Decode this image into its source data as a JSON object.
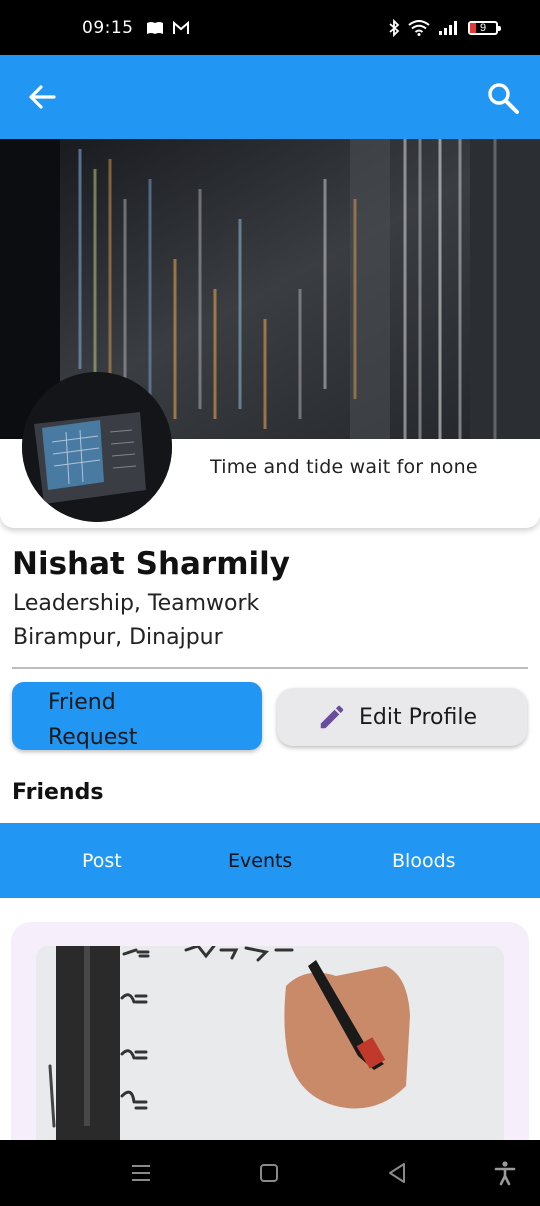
{
  "status_bar": {
    "time": "09:15",
    "battery": "9"
  },
  "app_bar": {
    "back_icon": "arrow-left-icon",
    "search_icon": "search-icon"
  },
  "profile": {
    "quote": "Time and tide wait for none",
    "name": "Nishat Sharmily",
    "skills": "Leadership, Teamwork",
    "location": "Birampur, Dinajpur"
  },
  "actions": {
    "friend_request_line1": "Friend",
    "friend_request_line2": "Request",
    "edit_profile": "Edit Profile"
  },
  "friends_title": "Friends",
  "tabs": [
    {
      "label": "Post"
    },
    {
      "label": "Events"
    },
    {
      "label": "Bloods"
    }
  ],
  "colors": {
    "accent": "#2196F3",
    "edit_icon": "#6A4C9C",
    "card_bg": "#F6EEFA"
  },
  "nav_bar": {
    "items": [
      "recent-apps-icon",
      "home-icon",
      "back-icon",
      "accessibility-icon"
    ]
  }
}
